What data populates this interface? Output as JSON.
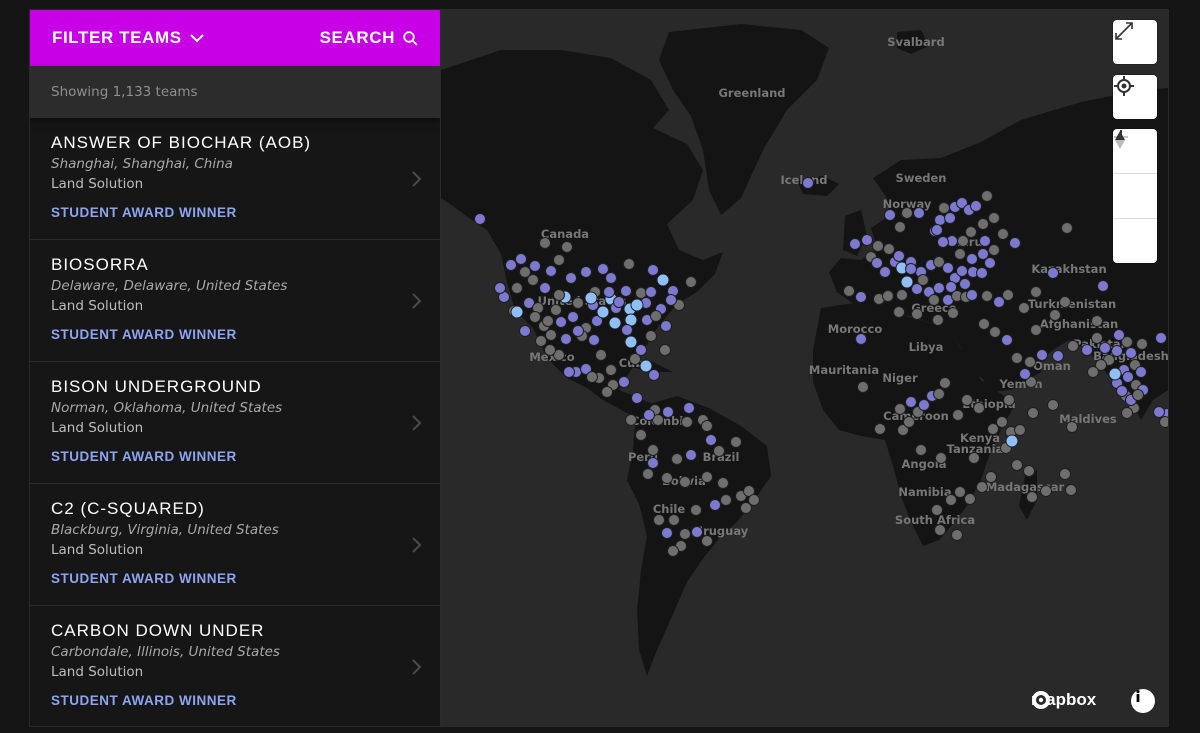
{
  "header": {
    "filter_label": "FILTER TEAMS",
    "search_label": "SEARCH"
  },
  "count_text": "Showing 1,133 teams",
  "teams": [
    {
      "name": "ANSWER OF BIOCHAR (AOB)",
      "location": "Shanghai, Shanghai, China",
      "type": "Land Solution",
      "award": "STUDENT AWARD WINNER"
    },
    {
      "name": "BIOSORRA",
      "location": "Delaware, Delaware, United States",
      "type": "Land Solution",
      "award": "STUDENT AWARD WINNER"
    },
    {
      "name": "BISON UNDERGROUND",
      "location": "Norman, Oklahoma, United States",
      "type": "Land Solution",
      "award": "STUDENT AWARD WINNER"
    },
    {
      "name": "C2 (C-SQUARED)",
      "location": "Blackburg, Virginia, United States",
      "type": "Land Solution",
      "award": "STUDENT AWARD WINNER"
    },
    {
      "name": "CARBON DOWN UNDER",
      "location": "Carbondale, Illinois, United States",
      "type": "Land Solution",
      "award": "STUDENT AWARD WINNER"
    }
  ],
  "map": {
    "labels": [
      "Svalbard",
      "Greenland",
      "Iceland",
      "Sweden",
      "Norway",
      "Canada",
      "Belarus",
      "Kazakhstan",
      "Turkmenistan",
      "Greece",
      "Afghanistan",
      "Pakistan",
      "Bangladesh",
      "Oman",
      "Yemen",
      "Maldives",
      "Morocco",
      "Libya",
      "Mauritania",
      "Niger",
      "Cameroon",
      "Ethiopia",
      "Kenya",
      "Tanzania",
      "Angola",
      "Namibia",
      "South Africa",
      "Madagascar",
      "Mexico",
      "Cuba",
      "Colombia",
      "Peru",
      "Brazil",
      "Bolivia",
      "Chile",
      "Uruguay",
      "United States"
    ],
    "attribution": "mapbox",
    "colors": {
      "land": "#141414",
      "water": "#292929",
      "marker_blue": "#8fbff7",
      "marker_purple": "#7c79d0",
      "marker_gray": "#6e6e6e"
    }
  },
  "icons": {
    "filter_chevron": "chevron-down-icon",
    "search": "search-icon",
    "list_chevron": "chevron-right-icon",
    "fullscreen": "fullscreen-icon",
    "locate": "geolocate-icon",
    "zoom_in": "zoom-in-icon",
    "zoom_out": "zoom-out-icon",
    "compass": "compass-icon",
    "info": "info-icon"
  }
}
